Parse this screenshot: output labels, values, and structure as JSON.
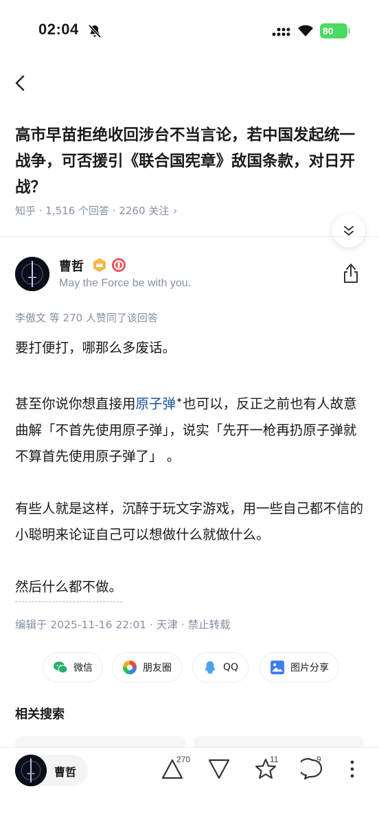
{
  "status": {
    "time": "02:04",
    "battery": "80"
  },
  "question": {
    "title": "高市早苗拒绝收回涉台不当言论，若中国发起统一战争，可否援引《联合国宪章》敌国条款，对日开战？",
    "meta": "知乎 · 1,516 个回答 · 2260 关注",
    "meta_chevron": "›"
  },
  "author": {
    "name": "曹哲",
    "bio": "May the Force be with you."
  },
  "voters": "李傲文 等 270 人赞同了该回答",
  "answer": {
    "p1": "要打便打，哪那么多废话。",
    "p2_before": "甚至你说你想直接用",
    "p2_link": "原子弹",
    "p2_spark": "✦",
    "p2_after": "也可以，反正之前也有人故意曲解「不首先使用原子弹」，说实「先开一枪再扔原子弹就不算首先使用原子弹了」 。",
    "p3": "有些人就是这样，沉醉于玩文字游戏，用一些自己都不信的小聪明来论证自己可以想做什么就做什么。",
    "p4": "然后什么都不做。"
  },
  "edit_meta": "编辑于 2025-11-16 22:01 · 天津 · 禁止转载",
  "share": {
    "wechat": "微信",
    "moments": "朋友圈",
    "qq": "QQ",
    "image": "图片分享"
  },
  "related_title": "相关搜索",
  "bottom_bar": {
    "author_name": "曹哲",
    "upvote_count": "270",
    "favorite_count": "11",
    "comment_count": "9"
  },
  "colors": {
    "link": "#175199",
    "meta": "#8590a6",
    "battery": "#4cd964"
  }
}
